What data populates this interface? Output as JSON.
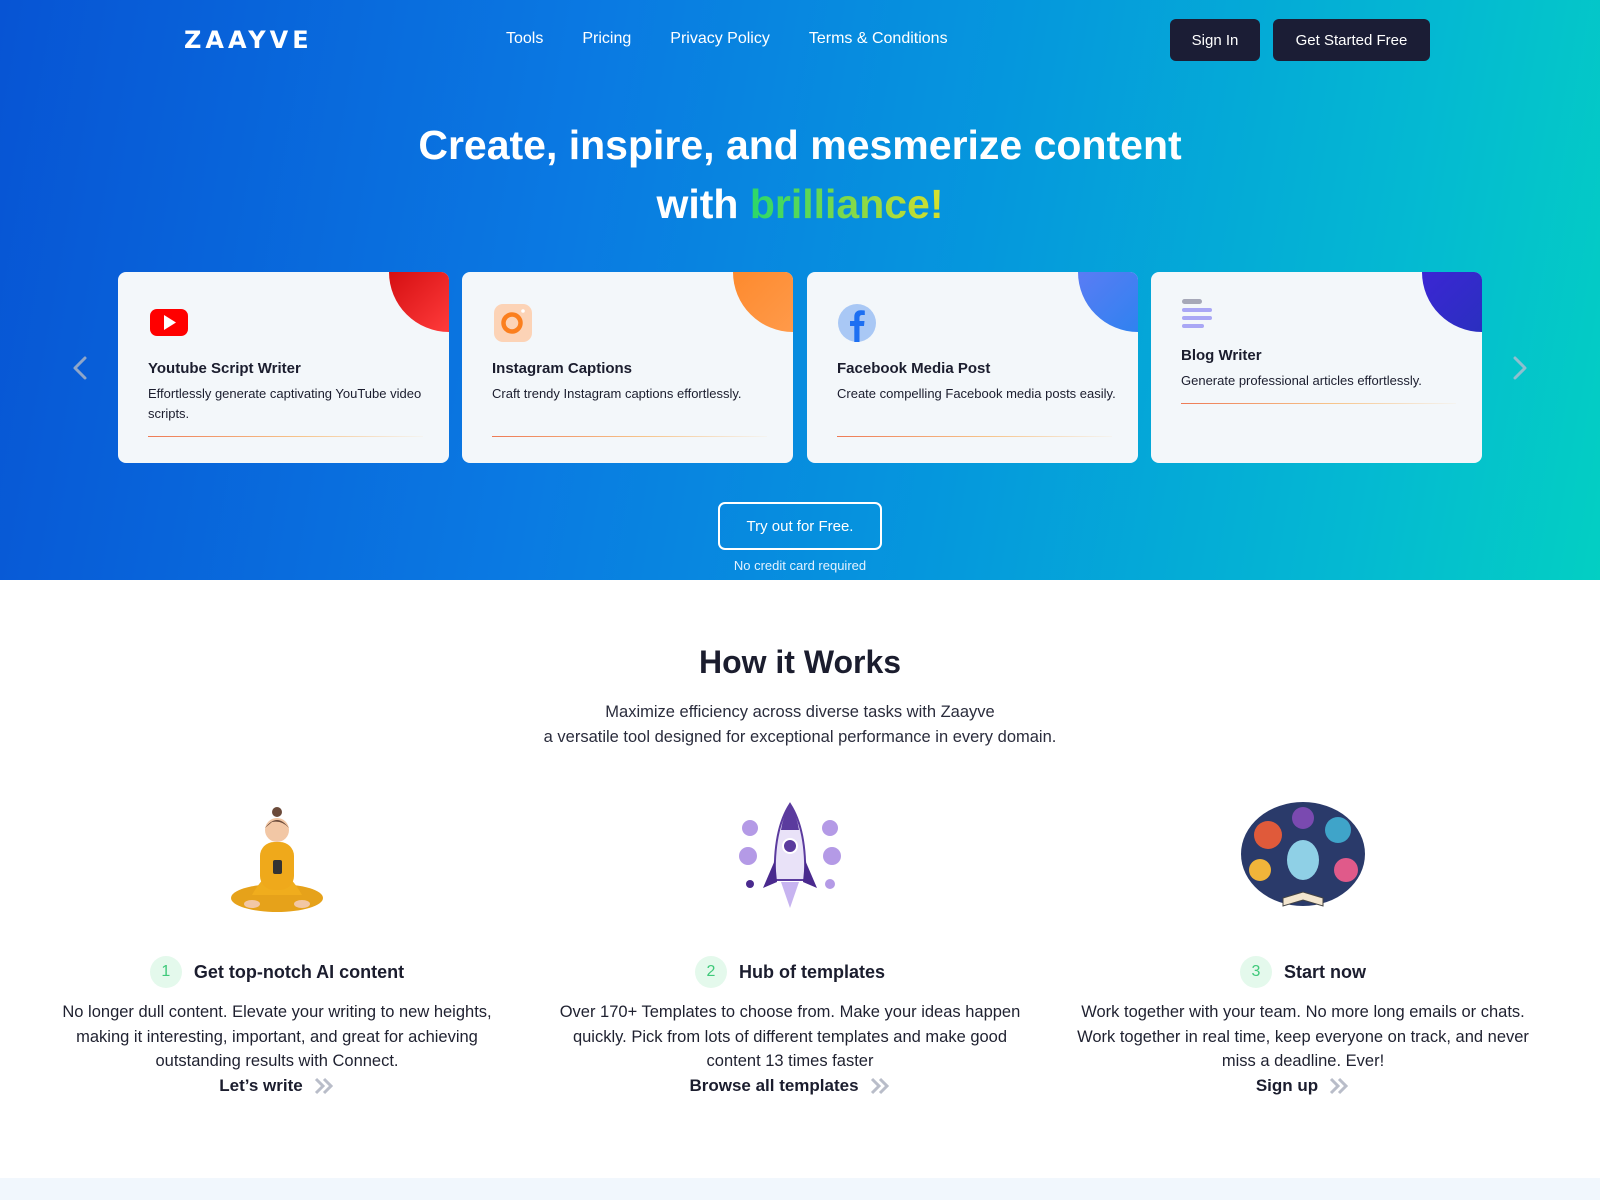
{
  "nav": {
    "logo": "ZAAYVE",
    "links": [
      "Tools",
      "Pricing",
      "Privacy Policy",
      "Terms & Conditions"
    ],
    "sign_in": "Sign In",
    "get_started": "Get Started Free"
  },
  "hero": {
    "title_line1": "Create, inspire, and mesmerize content",
    "title_line2_prefix": "with ",
    "title_highlight": "brilliance!",
    "cards": [
      {
        "title": "Youtube Script Writer",
        "desc": "Effortlessly generate captivating YouTube video scripts.",
        "icon": "youtube-icon",
        "accent": "#f0222a"
      },
      {
        "title": "Instagram Captions",
        "desc": "Craft trendy Instagram captions effortlessly.",
        "icon": "instagram-icon",
        "accent": "#fd8a35"
      },
      {
        "title": "Facebook Media Post",
        "desc": "Create compelling Facebook media posts easily.",
        "icon": "facebook-icon",
        "accent": "#3c7cf2"
      },
      {
        "title": "Blog Writer",
        "desc": "Generate professional articles effortlessly.",
        "icon": "blog-lines-icon",
        "accent": "#3a2ad6"
      }
    ],
    "try_button": "Try out for Free.",
    "no_credit": "No credit card required"
  },
  "how": {
    "title": "How it Works",
    "subtitle_line1": "Maximize efficiency across diverse tasks with Zaayve",
    "subtitle_line2": "a versatile tool designed for exceptional performance in every domain.",
    "steps": [
      {
        "num": "1",
        "title": "Get top-notch AI content",
        "desc": "No longer dull content. Elevate your writing to new heights, making it interesting, important, and great for achieving outstanding results with Connect.",
        "cta": "Let’s write"
      },
      {
        "num": "2",
        "title": "Hub of templates",
        "desc": "Over 170+ Templates to choose from. Make your ideas happen quickly. Pick from lots of different templates and make good content 13 times faster",
        "cta": "Browse all templates"
      },
      {
        "num": "3",
        "title": "Start now",
        "desc": "Work together with your team. No more long emails or chats. Work together in real time, keep everyone on track, and never miss a deadline. Ever!",
        "cta": "Sign up"
      }
    ]
  },
  "colors": {
    "dark_button": "#1b1d35",
    "step_number": "#3fc97a",
    "highlight_start": "#2bd86a",
    "highlight_end": "#d9e02b"
  }
}
